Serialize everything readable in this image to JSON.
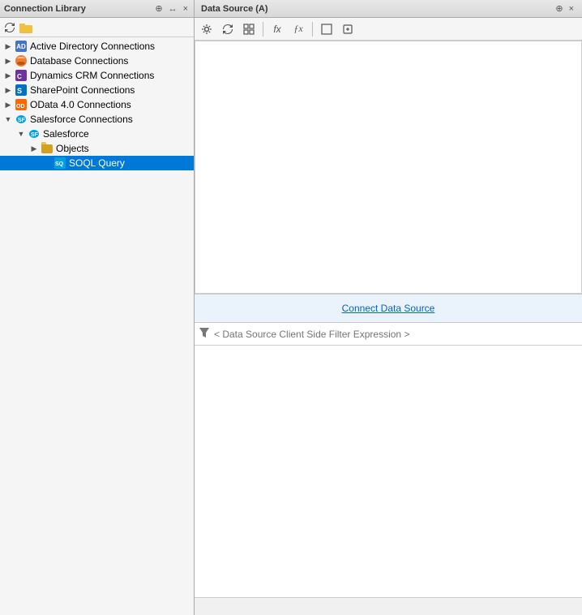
{
  "leftPanel": {
    "title": "Connection Library",
    "headerIcons": [
      "⊕",
      "↔",
      "×"
    ],
    "toolbar": {
      "refreshIcon": "↺",
      "folderIcon": "📁"
    },
    "tree": [
      {
        "id": "active-directory",
        "label": "Active Directory Connections",
        "iconType": "ad",
        "indent": 0,
        "toggle": "collapsed",
        "selected": false
      },
      {
        "id": "database",
        "label": "Database Connections",
        "iconType": "db",
        "indent": 0,
        "toggle": "collapsed",
        "selected": false
      },
      {
        "id": "dynamics-crm",
        "label": "Dynamics CRM Connections",
        "iconType": "crm",
        "indent": 0,
        "toggle": "collapsed",
        "selected": false
      },
      {
        "id": "sharepoint",
        "label": "SharePoint Connections",
        "iconType": "sp",
        "indent": 0,
        "toggle": "collapsed",
        "selected": false
      },
      {
        "id": "odata",
        "label": "OData 4.0 Connections",
        "iconType": "odata",
        "indent": 0,
        "toggle": "collapsed",
        "selected": false
      },
      {
        "id": "salesforce-connections",
        "label": "Salesforce Connections",
        "iconType": "sf",
        "indent": 0,
        "toggle": "expanded",
        "selected": false
      },
      {
        "id": "salesforce",
        "label": "Salesforce",
        "iconType": "sf",
        "indent": 1,
        "toggle": "expanded",
        "selected": false
      },
      {
        "id": "objects",
        "label": "Objects",
        "iconType": "folder",
        "indent": 2,
        "toggle": "collapsed",
        "selected": false
      },
      {
        "id": "soql-query",
        "label": "SOQL Query",
        "iconType": "leaf",
        "indent": 3,
        "toggle": "leaf",
        "selected": true
      }
    ]
  },
  "rightPanel": {
    "title": "Data Source (A)",
    "toolbar": {
      "buttons": [
        "⚙",
        "↺",
        "▦",
        "fx",
        "ƒx",
        "⬜",
        "◻"
      ]
    },
    "connectBar": {
      "linkText": "Connect Data Source"
    },
    "filterBar": {
      "placeholder": "< Data Source Client Side Filter Expression >"
    }
  }
}
